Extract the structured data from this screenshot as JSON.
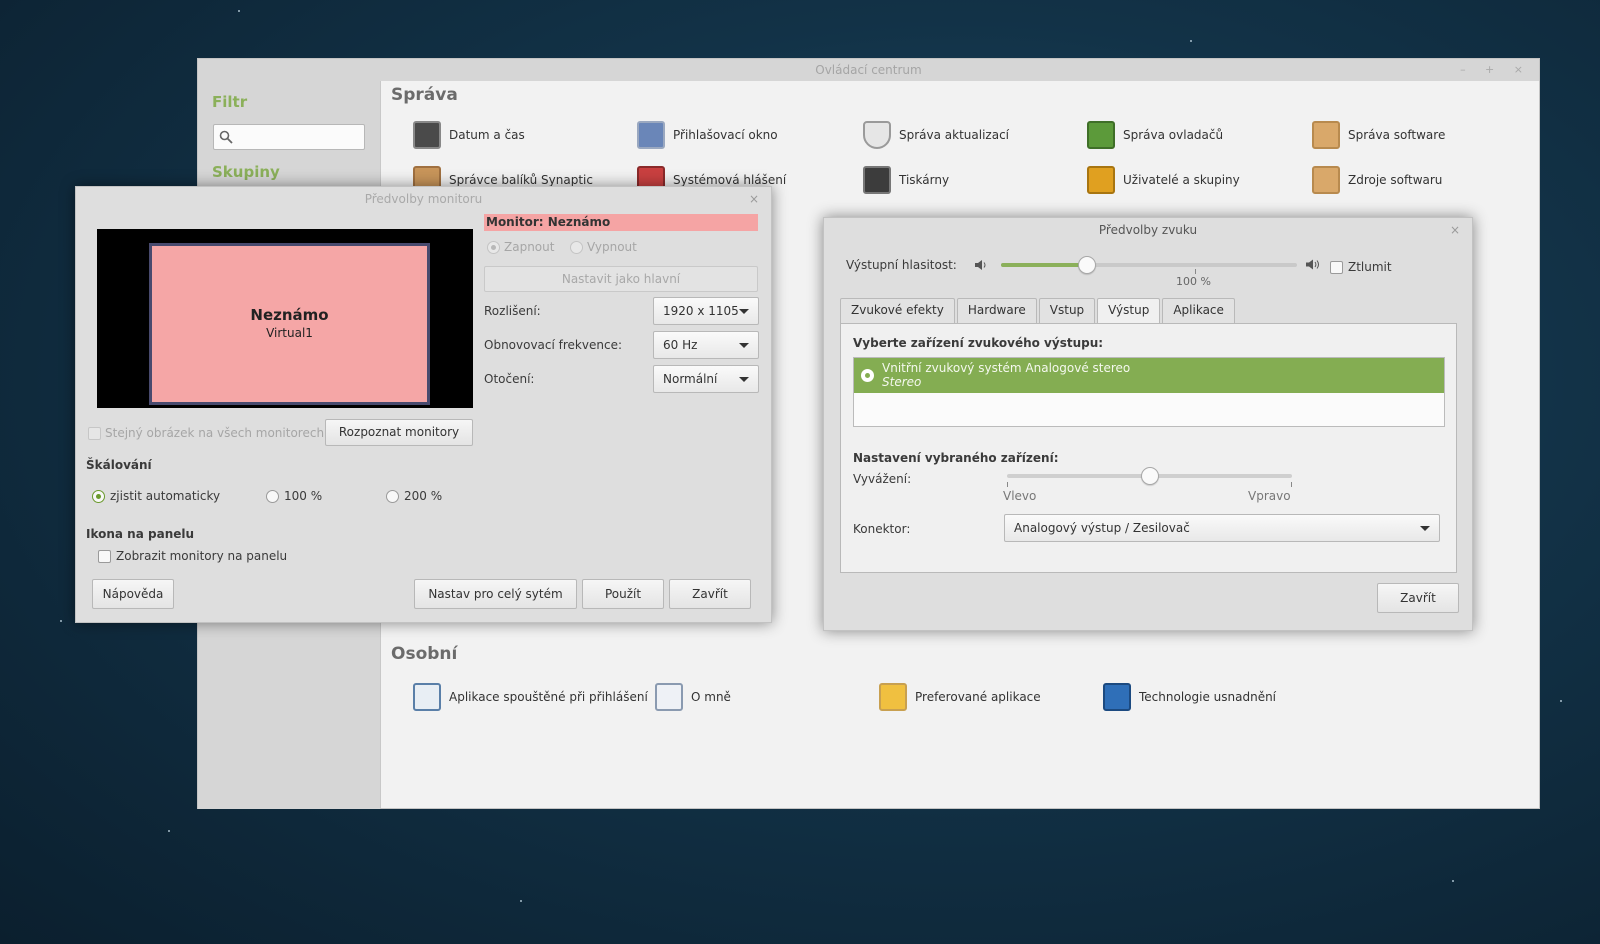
{
  "control_center": {
    "title": "Ovládací centrum",
    "window_controls": "– + ×",
    "sidebar": {
      "filter_heading": "Filtr",
      "search_placeholder": "",
      "groups_heading": "Skupiny"
    },
    "sections": {
      "admin_title": "Správa",
      "admin_items": [
        "Datum a čas",
        "Přihlašovací okno",
        "Správa aktualizací",
        "Správa ovladačů",
        "Správa software",
        "Správce balíků Synaptic",
        "Systémová hlášení",
        "Tiskárny",
        "Uživatelé a skupiny",
        "Zdroje softwaru"
      ],
      "personal_title": "Osobní",
      "personal_items": [
        "Aplikace spouštěné při přihlášení",
        "O mně",
        "Preferované aplikace",
        "Technologie usnadnění"
      ]
    }
  },
  "monitor_dialog": {
    "title": "Předvolby monitoru",
    "close": "×",
    "preview": {
      "name": "Neznámo",
      "output": "Virtual1"
    },
    "banner": "Monitor: Neznámo",
    "on_label": "Zapnout",
    "off_label": "Vypnout",
    "set_primary": "Nastavit jako hlavní",
    "resolution_label": "Rozlišení:",
    "resolution_value": "1920 x 1105",
    "refresh_label": "Obnovovací frekvence:",
    "refresh_value": "60 Hz",
    "rotation_label": "Otočení:",
    "rotation_value": "Normální",
    "same_image_label": "Stejný obrázek na všech monitorech",
    "detect_button": "Rozpoznat monitory",
    "scaling_heading": "Škálování",
    "scaling_options": [
      "zjistit automaticky",
      "100 %",
      "200 %"
    ],
    "panel_heading": "Ikona na panelu",
    "panel_checkbox": "Zobrazit monitory na panelu",
    "help_button": "Nápověda",
    "system_button": "Nastav pro celý sytém",
    "apply_button": "Použít",
    "close_button": "Zavřít"
  },
  "sound_dialog": {
    "title": "Předvolby zvuku",
    "close": "×",
    "volume_label": "Výstupní hlasitost:",
    "volume_mark": "100 %",
    "volume_level": 0.29,
    "mute_label": "Ztlumit",
    "tabs": [
      "Zvukové efekty",
      "Hardware",
      "Vstup",
      "Výstup",
      "Aplikace"
    ],
    "active_tab": "Výstup",
    "choose_device_heading": "Vyberte zařízení zvukového výstupu:",
    "device_name": "Vnitřní zvukový systém Analogové stereo",
    "device_profile": "Stereo",
    "selected_settings_heading": "Nastavení vybraného zařízení:",
    "balance_label": "Vyvážení:",
    "balance_left": "Vlevo",
    "balance_right": "Vpravo",
    "balance_level": 0.5,
    "connector_label": "Konektor:",
    "connector_value": "Analogový výstup / Zesilovač",
    "close_button": "Zavřít"
  },
  "colors": {
    "accent_green": "#84ad52",
    "monitor_pink": "#f5a6a6"
  }
}
